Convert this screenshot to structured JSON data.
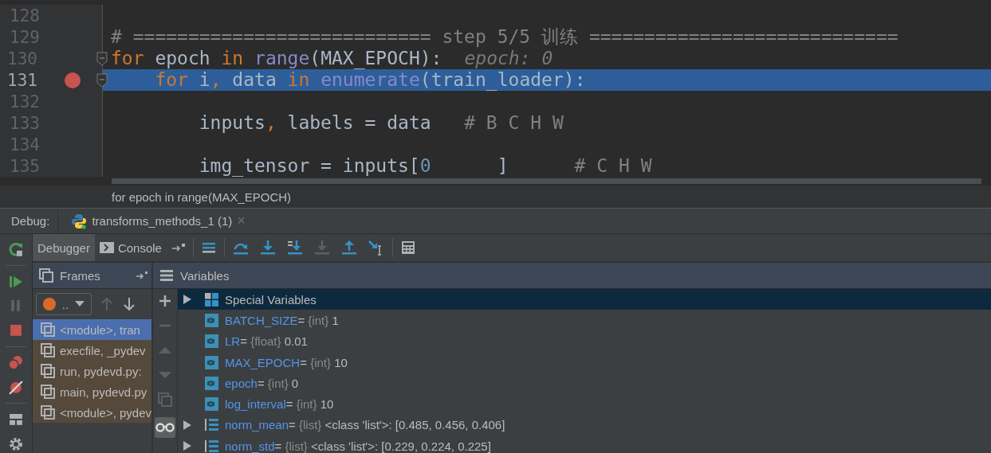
{
  "editor": {
    "lines": [
      {
        "number": "128",
        "current": false,
        "breakpoint": false,
        "fold": false
      },
      {
        "number": "129",
        "current": false,
        "breakpoint": false,
        "fold": false,
        "tokens": [
          {
            "kind": "comment",
            "text": "# =========================== step 5/5 训练 ============================"
          }
        ]
      },
      {
        "number": "130",
        "current": false,
        "breakpoint": false,
        "fold": true,
        "tokens": [
          {
            "kind": "keyword",
            "text": "for"
          },
          {
            "kind": "plain",
            "text": " epoch "
          },
          {
            "kind": "keyword",
            "text": "in"
          },
          {
            "kind": "builtin",
            "text": " range"
          },
          {
            "kind": "plain",
            "text": "(MAX_EPOCH):"
          },
          {
            "kind": "hint",
            "text": "epoch: 0"
          }
        ]
      },
      {
        "number": "131",
        "current": true,
        "breakpoint": true,
        "fold": true,
        "tokens": [
          {
            "kind": "keyword",
            "text": "    for"
          },
          {
            "kind": "plain",
            "text": " i"
          },
          {
            "kind": "keyword",
            "text": ","
          },
          {
            "kind": "plain",
            "text": " data "
          },
          {
            "kind": "keyword",
            "text": "in"
          },
          {
            "kind": "builtin",
            "text": " enumerate"
          },
          {
            "kind": "plain",
            "text": "(train_loader):"
          }
        ]
      },
      {
        "number": "132",
        "current": false,
        "breakpoint": false,
        "fold": false
      },
      {
        "number": "133",
        "current": false,
        "breakpoint": false,
        "fold": false,
        "tokens": [
          {
            "kind": "plain",
            "text": "        inputs"
          },
          {
            "kind": "keyword",
            "text": ","
          },
          {
            "kind": "plain",
            "text": " labels = data   "
          },
          {
            "kind": "comment",
            "text": "# B C H W"
          }
        ]
      },
      {
        "number": "134",
        "current": false,
        "breakpoint": false,
        "fold": false
      },
      {
        "number": "135",
        "current": false,
        "breakpoint": false,
        "fold": false,
        "tokens": [
          {
            "kind": "plain",
            "text": "        img_tensor = inputs["
          },
          {
            "kind": "number",
            "text": "0"
          },
          {
            "kind": "plain",
            "text": "      ]      "
          },
          {
            "kind": "comment",
            "text": "# C H W"
          }
        ]
      }
    ],
    "breadcrumb": "for epoch in range(MAX_EPOCH)"
  },
  "debug": {
    "label": "Debug:",
    "tab": {
      "title": "transforms_methods_1 (1)",
      "close": "×"
    },
    "tabs": [
      {
        "label": "Debugger",
        "selected": true
      },
      {
        "label": "Console",
        "selected": false
      }
    ],
    "frames": {
      "title": "Frames",
      "thread": "..",
      "items": [
        {
          "text": "<module>, tran",
          "selected": true
        },
        {
          "text": "execfile, _pydev",
          "selected": false
        },
        {
          "text": "run, pydevd.py:",
          "selected": false
        },
        {
          "text": "main, pydevd.py",
          "selected": false
        },
        {
          "text": "<module>, pydev",
          "selected": false
        }
      ]
    },
    "variables": {
      "title": "Variables",
      "items": [
        {
          "kind": "group",
          "name": "Special Variables",
          "selected": true
        },
        {
          "kind": "scalar",
          "name": "BATCH_SIZE",
          "sep": "=",
          "type": "{int}",
          "value": "1",
          "selected": false
        },
        {
          "kind": "scalar",
          "name": "LR",
          "sep": "=",
          "type": "{float}",
          "value": "0.01",
          "selected": false
        },
        {
          "kind": "scalar",
          "name": "MAX_EPOCH",
          "sep": "=",
          "type": "{int}",
          "value": "10",
          "selected": false
        },
        {
          "kind": "scalar",
          "name": "epoch",
          "sep": "=",
          "type": "{int}",
          "value": "0",
          "selected": false
        },
        {
          "kind": "scalar",
          "name": "log_interval",
          "sep": "=",
          "type": "{int}",
          "value": "10",
          "selected": false
        },
        {
          "kind": "list",
          "name": "norm_mean",
          "sep": "=",
          "type": "{list}",
          "value": "<class 'list'>: [0.485, 0.456, 0.406]",
          "selected": false
        },
        {
          "kind": "list",
          "name": "norm_std",
          "sep": "=",
          "type": "{list}",
          "value": "<class 'list'>: [0.229, 0.224, 0.225]",
          "selected": false
        }
      ]
    }
  }
}
